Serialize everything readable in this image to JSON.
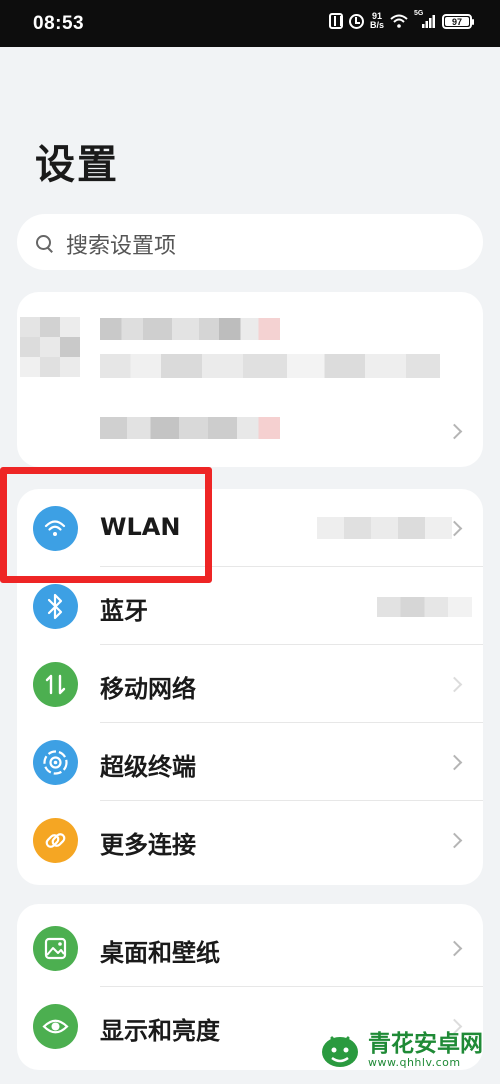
{
  "status_bar": {
    "time": "08:53",
    "net_speed_value": "91",
    "net_speed_unit": "B/s",
    "signal_label": "5G",
    "battery": "97"
  },
  "page": {
    "title": "设置"
  },
  "search": {
    "placeholder": "搜索设置项"
  },
  "connectivity": {
    "items": [
      {
        "label": "WLAN",
        "icon": "wifi-icon",
        "color": "#3da0e4"
      },
      {
        "label": "蓝牙",
        "icon": "bluetooth-icon",
        "color": "#3da0e4"
      },
      {
        "label": "移动网络",
        "icon": "mobile-data-icon",
        "color": "#4caf50"
      },
      {
        "label": "超级终端",
        "icon": "super-device-icon",
        "color": "#3da0e4"
      },
      {
        "label": "更多连接",
        "icon": "link-icon",
        "color": "#f5a623"
      }
    ]
  },
  "display": {
    "items": [
      {
        "label": "桌面和壁纸",
        "icon": "wallpaper-icon",
        "color": "#4caf50"
      },
      {
        "label": "显示和亮度",
        "icon": "eye-icon",
        "color": "#4caf50"
      }
    ]
  },
  "watermark": {
    "name": "青花安卓网",
    "url": "www.qhhlv.com"
  }
}
